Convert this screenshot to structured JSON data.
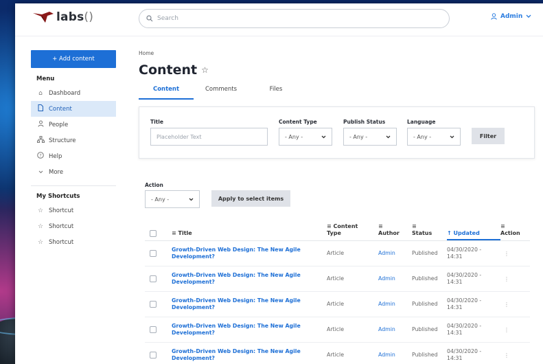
{
  "brand": {
    "name": "labs",
    "suffix": "()"
  },
  "search": {
    "placeholder": "Search"
  },
  "user": {
    "name": "Admin"
  },
  "sidebar": {
    "add_label": "+ Add content",
    "menu_heading": "Menu",
    "items": [
      {
        "label": "Dashboard",
        "icon": "home-icon"
      },
      {
        "label": "Content",
        "icon": "document-icon"
      },
      {
        "label": "People",
        "icon": "person-icon"
      },
      {
        "label": "Structure",
        "icon": "sitemap-icon"
      },
      {
        "label": "Help",
        "icon": "help-icon"
      },
      {
        "label": "More",
        "icon": "chevron-down-icon"
      }
    ],
    "shortcuts_heading": "My Shortcuts",
    "shortcuts": [
      "Shortcut",
      "Shortcut",
      "Shortcut"
    ]
  },
  "main": {
    "breadcrumb": "Home",
    "title": "Content",
    "tabs": [
      "Content",
      "Comments",
      "Files"
    ],
    "filters": {
      "title_label": "Title",
      "title_placeholder": "Placeholder Text",
      "type_label": "Content Type",
      "type_value": "- Any -",
      "status_label": "Publish Status",
      "status_value": "- Any -",
      "lang_label": "Language",
      "lang_value": "- Any -",
      "filter_button": "Filter"
    },
    "action": {
      "label": "Action",
      "value": "- Any -",
      "apply_button": "Apply to select items"
    }
  },
  "table": {
    "headers": {
      "title": "Title",
      "type_line1": "Content",
      "type_line2": "Type",
      "author": "Author",
      "status": "Status",
      "updated": "Updated",
      "action": "Action"
    },
    "rows": [
      {
        "title_line1": "Growth-Driven Web Design: The New Agile",
        "title_line2": "Development?",
        "type": "Article",
        "author": "Admin",
        "status": "Published",
        "updated_line1": "04/30/2020 -",
        "updated_line2": "14:31"
      },
      {
        "title_line1": "Growth-Driven Web Design: The New Agile",
        "title_line2": "Development?",
        "type": "Article",
        "author": "Admin",
        "status": "Published",
        "updated_line1": "04/30/2020 -",
        "updated_line2": "14:31"
      },
      {
        "title_line1": "Growth-Driven Web Design: The New Agile",
        "title_line2": "Development?",
        "type": "Article",
        "author": "Admin",
        "status": "Published",
        "updated_line1": "04/30/2020 -",
        "updated_line2": "14:31"
      },
      {
        "title_line1": "Growth-Driven Web Design: The New Agile",
        "title_line2": "Development?",
        "type": "Article",
        "author": "Admin",
        "status": "Published",
        "updated_line1": "04/30/2020 -",
        "updated_line2": "14:31"
      },
      {
        "title_line1": "Growth-Driven Web Design: The New Agile",
        "title_line2": "Development?",
        "type": "Article",
        "author": "Admin",
        "status": "Published",
        "updated_line1": "04/30/2020 -",
        "updated_line2": "14:31"
      }
    ]
  },
  "colors": {
    "accent": "#1d6fd6",
    "active_bg": "#dbe9f9",
    "button_gray": "#dfe2e8",
    "logo_red": "#8b1a1a"
  }
}
